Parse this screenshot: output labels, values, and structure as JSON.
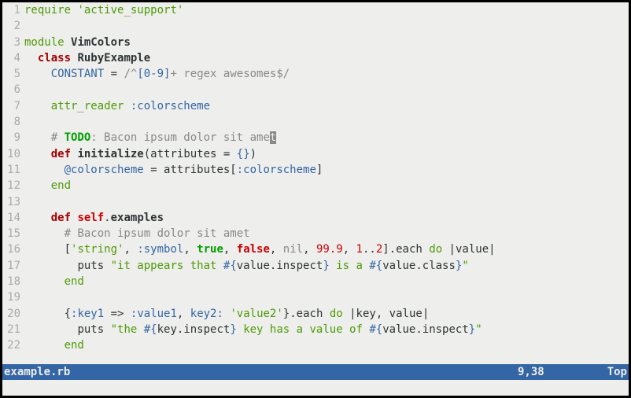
{
  "status": {
    "filename": "example.rb",
    "position": "9,38",
    "scroll": "Top"
  },
  "lines": {
    "l1_require": "require",
    "l1_lib": "'active_support'",
    "l3_module": "module",
    "l3_name": "VimColors",
    "l4_class": "class",
    "l4_name": "RubyExample",
    "l5_const": "CONSTANT",
    "l5_eq": " = ",
    "l5_rx1": "/^",
    "l5_rx2": "[0-9]",
    "l5_rx3": "+",
    "l5_rx4": " regex awesomes",
    "l5_rx5": "$/",
    "l7_attr": "attr_reader",
    "l7_sym": ":colorscheme",
    "l9_hash": "# ",
    "l9_todo": "TODO",
    "l9_rest": ": Bacon ipsum dolor sit ame",
    "l9_cursor": "t",
    "l10_def": "def",
    "l10_name": "initialize",
    "l10_p1": "(attributes = ",
    "l10_p2": "{}",
    "l10_p3": ")",
    "l11_ivar": "@colorscheme",
    "l11_eq": " = attributes[",
    "l11_sym": ":colorscheme",
    "l11_close": "]",
    "l12_end": "end",
    "l14_def": "def",
    "l14_self": "self",
    "l14_dot": ".",
    "l14_name": "examples",
    "l15_comment": "# Bacon ipsum dolor sit amet",
    "l16_br": "[",
    "l16_str": "'string'",
    "l16_c1": ", ",
    "l16_sym": ":symbol",
    "l16_c2": ", ",
    "l16_true": "true",
    "l16_c3": ", ",
    "l16_false": "false",
    "l16_c4": ", ",
    "l16_nil": "nil",
    "l16_c5": ", ",
    "l16_n1": "99.9",
    "l16_c6": ", ",
    "l16_na": "1",
    "l16_range": "..",
    "l16_nb": "2",
    "l16_cl": "].each ",
    "l16_do": "do",
    "l16_blk": " |value|",
    "l17_puts": "puts ",
    "l17_s1": "\"it appears that ",
    "l17_i1o": "#{",
    "l17_i1b": "value.inspect",
    "l17_i1c": "}",
    "l17_s2": " is a ",
    "l17_i2o": "#{",
    "l17_i2b": "value.class",
    "l17_i2c": "}",
    "l17_s3": "\"",
    "l18_end": "end",
    "l20_open": "{",
    "l20_k1": ":key1",
    "l20_ar1": " => ",
    "l20_v1": ":value1",
    "l20_c1": ", ",
    "l20_k2": "key2:",
    "l20_sp": " ",
    "l20_v2": "'value2'",
    "l20_close": "}.each ",
    "l20_do": "do",
    "l20_blk": " |key, value|",
    "l21_puts": "puts ",
    "l21_s1": "\"the ",
    "l21_i1o": "#{",
    "l21_i1b": "key.inspect",
    "l21_i1c": "}",
    "l21_s2": " key has a value of ",
    "l21_i2o": "#{",
    "l21_i2b": "value.inspect",
    "l21_i2c": "}",
    "l21_s3": "\"",
    "l22_end": "end"
  },
  "gutter": [
    "1",
    "2",
    "3",
    "4",
    "5",
    "6",
    "7",
    "8",
    "9",
    "10",
    "11",
    "12",
    "13",
    "14",
    "15",
    "16",
    "17",
    "18",
    "19",
    "20",
    "21",
    "22"
  ]
}
